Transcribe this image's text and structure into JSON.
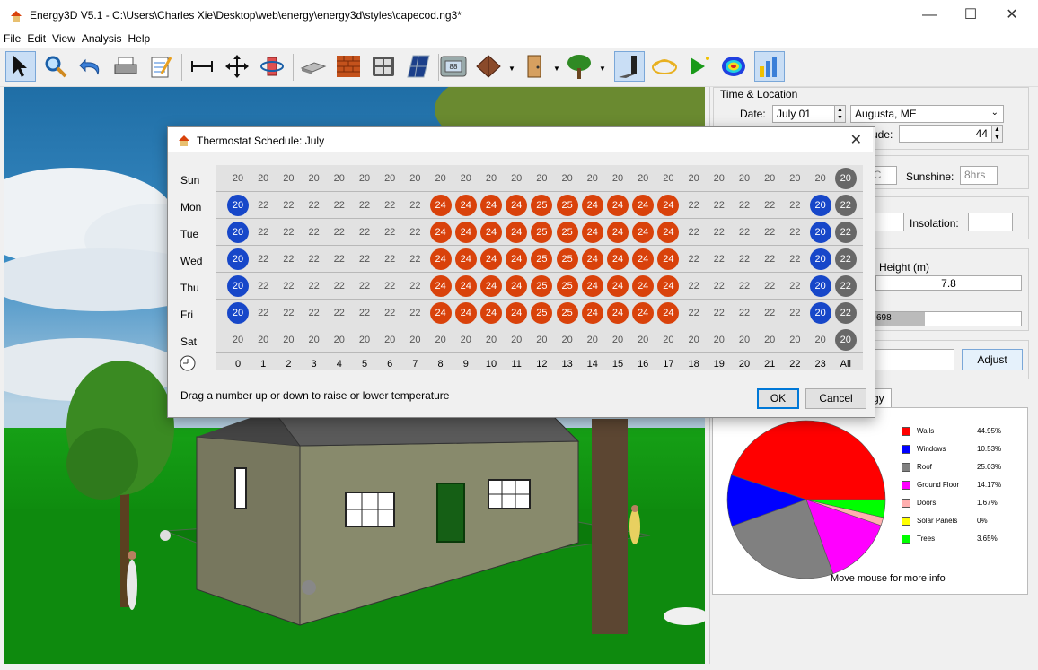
{
  "window": {
    "title": "Energy3D V5.1 - C:\\Users\\Charles Xie\\Desktop\\web\\energy\\energy3d\\styles\\capecod.ng3*"
  },
  "menu": [
    "File",
    "Edit",
    "View",
    "Analysis",
    "Help"
  ],
  "toolbar_icons": [
    "select-arrow-icon",
    "zoom-icon",
    "undo-icon",
    "print-icon",
    "notes-icon",
    "measure-icon",
    "move-icon",
    "rotate-icon",
    "foundation-icon",
    "wall-icon",
    "window-icon",
    "solar-panel-icon",
    "thermostat-icon",
    "roof-icon",
    "door-icon",
    "tree-icon",
    "shadow-icon",
    "heliodon-icon",
    "run-simulation-icon",
    "heat-map-icon",
    "graph-icon"
  ],
  "side": {
    "time_location_title": "Time & Location",
    "date_label": "Date:",
    "date_value": "July 01",
    "city_value": "Augusta, ME",
    "latitude_label_partial": "ude:",
    "latitude_value": "44",
    "temp_partial": "°C",
    "sunshine_label": "Sunshine:",
    "sunshine_value": "8hrs",
    "insolation_label": "Insolation:",
    "height_label": "Height (m)",
    "height_value": "7.8",
    "cost_partial": "698",
    "adjust_button": "Adjust",
    "tab_partial": "rgy"
  },
  "pie": {
    "footer": "Move mouse for more info",
    "legend": [
      {
        "name": "Walls",
        "pct": "44.95%",
        "color": "#ff0000",
        "value": 44.95
      },
      {
        "name": "Windows",
        "pct": "10.53%",
        "color": "#0000ff",
        "value": 10.53
      },
      {
        "name": "Roof",
        "pct": "25.03%",
        "color": "#808080",
        "value": 25.03
      },
      {
        "name": "Ground Floor",
        "pct": "14.17%",
        "color": "#ff00ff",
        "value": 14.17
      },
      {
        "name": "Doors",
        "pct": "1.67%",
        "color": "#ffafaf",
        "value": 1.67
      },
      {
        "name": "Solar Panels",
        "pct": "0%",
        "color": "#ffff00",
        "value": 0
      },
      {
        "name": "Trees",
        "pct": "3.65%",
        "color": "#00ff00",
        "value": 3.65
      }
    ]
  },
  "dialog": {
    "title": "Thermostat Schedule: July",
    "hint": "Drag a number up or down to raise or lower temperature",
    "ok": "OK",
    "cancel": "Cancel",
    "hours": [
      "0",
      "1",
      "2",
      "3",
      "4",
      "5",
      "6",
      "7",
      "8",
      "9",
      "10",
      "11",
      "12",
      "13",
      "14",
      "15",
      "16",
      "17",
      "18",
      "19",
      "20",
      "21",
      "22",
      "23",
      "All"
    ],
    "days": [
      {
        "name": "Sun",
        "temps": [
          20,
          20,
          20,
          20,
          20,
          20,
          20,
          20,
          20,
          20,
          20,
          20,
          20,
          20,
          20,
          20,
          20,
          20,
          20,
          20,
          20,
          20,
          20,
          20
        ],
        "all": "20"
      },
      {
        "name": "Mon",
        "temps": [
          20,
          22,
          22,
          22,
          22,
          22,
          22,
          22,
          24,
          24,
          24,
          24,
          25,
          25,
          24,
          24,
          24,
          24,
          22,
          22,
          22,
          22,
          22,
          20
        ],
        "all": "22"
      },
      {
        "name": "Tue",
        "temps": [
          20,
          22,
          22,
          22,
          22,
          22,
          22,
          22,
          24,
          24,
          24,
          24,
          25,
          25,
          24,
          24,
          24,
          24,
          22,
          22,
          22,
          22,
          22,
          20
        ],
        "all": "22"
      },
      {
        "name": "Wed",
        "temps": [
          20,
          22,
          22,
          22,
          22,
          22,
          22,
          22,
          24,
          24,
          24,
          24,
          25,
          25,
          24,
          24,
          24,
          24,
          22,
          22,
          22,
          22,
          22,
          20
        ],
        "all": "22"
      },
      {
        "name": "Thu",
        "temps": [
          20,
          22,
          22,
          22,
          22,
          22,
          22,
          22,
          24,
          24,
          24,
          24,
          25,
          25,
          24,
          24,
          24,
          24,
          22,
          22,
          22,
          22,
          22,
          20
        ],
        "all": "22"
      },
      {
        "name": "Fri",
        "temps": [
          20,
          22,
          22,
          22,
          22,
          22,
          22,
          22,
          24,
          24,
          24,
          24,
          25,
          25,
          24,
          24,
          24,
          24,
          22,
          22,
          22,
          22,
          22,
          20
        ],
        "all": "22"
      },
      {
        "name": "Sat",
        "temps": [
          20,
          20,
          20,
          20,
          20,
          20,
          20,
          20,
          20,
          20,
          20,
          20,
          20,
          20,
          20,
          20,
          20,
          20,
          20,
          20,
          20,
          20,
          20,
          20
        ],
        "all": "20"
      }
    ],
    "highlight": {
      "hot_hours_weekday": [
        8,
        9,
        10,
        11,
        12,
        13,
        14,
        15,
        16,
        17
      ],
      "cool_hours_weekday": [
        0,
        23
      ]
    }
  }
}
